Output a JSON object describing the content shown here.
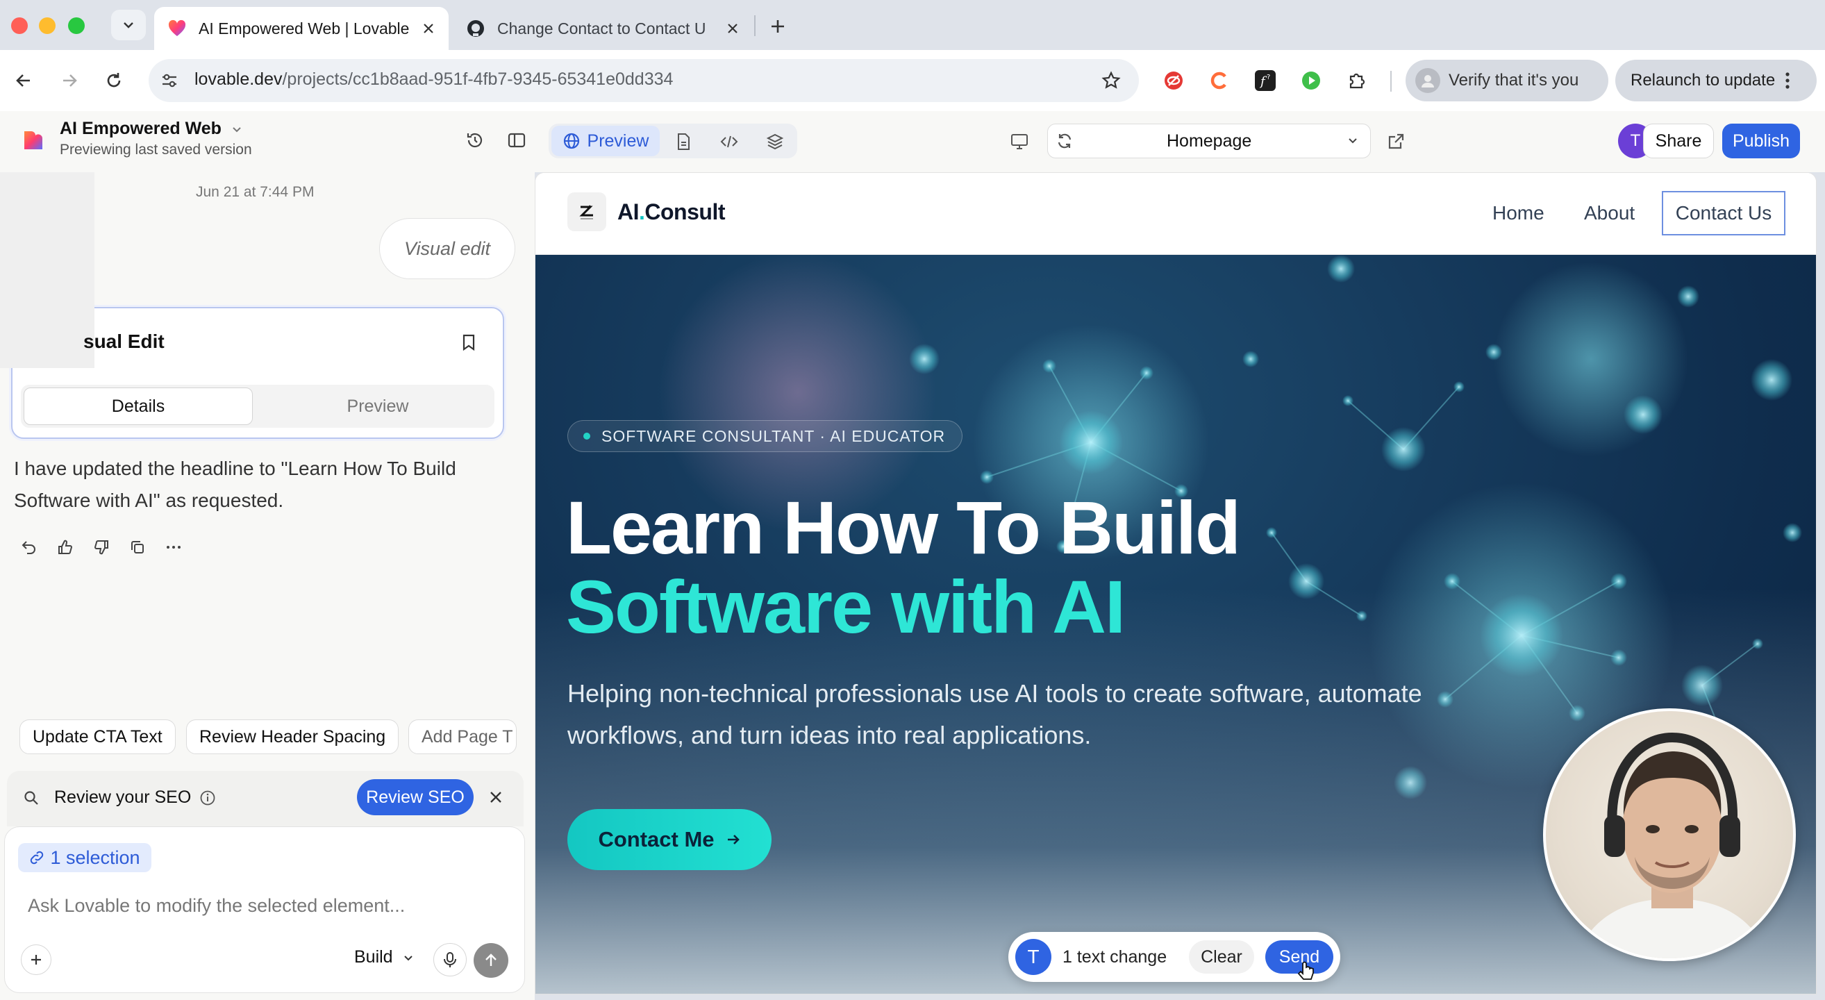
{
  "browser": {
    "tabs": [
      {
        "title": "AI Empowered Web | Lovable",
        "active": true
      },
      {
        "title": "Change Contact to Contact U",
        "active": false
      }
    ],
    "url_host": "lovable.dev",
    "url_path": "/projects/cc1b8aad-951f-4fb7-9345-65341e0dd334",
    "verify_label": "Verify that it's you",
    "relaunch_label": "Relaunch to update"
  },
  "header": {
    "project_name": "AI Empowered Web",
    "project_status": "Previewing last saved version",
    "preview_label": "Preview",
    "page_selected": "Homepage",
    "avatar_initial": "T",
    "share_label": "Share",
    "publish_label": "Publish"
  },
  "chat": {
    "date": "Jun 21 at 7:44 PM",
    "user_bubble": "Visual edit",
    "card_title": "sual Edit",
    "card_tabs": [
      "Details",
      "Preview"
    ],
    "assistant_message": "I have updated the headline to \"Learn How To Build Software with AI\" as requested.",
    "suggestions": [
      "Update CTA Text",
      "Review Header Spacing",
      "Add Page T"
    ],
    "seo_label": "Review your SEO",
    "seo_button": "Review SEO",
    "selection_chip": "1 selection",
    "input_placeholder": "Ask Lovable to modify the selected element...",
    "mode": "Build"
  },
  "site": {
    "brand_a": "AI",
    "brand_dot": ".",
    "brand_b": "Consult",
    "nav": [
      "Home",
      "About",
      "Contact Us"
    ],
    "badge": "SOFTWARE CONSULTANT · AI EDUCATOR",
    "headline_line1": "Learn How To Build",
    "headline_line2": "Software with AI",
    "subheadline": "Helping non-technical professionals use AI tools to create software, automate workflows, and turn ideas into real applications.",
    "cta": "Contact Me"
  },
  "change_bar": {
    "avatar": "T",
    "text": "1 text change",
    "clear": "Clear",
    "send": "Send"
  },
  "colors": {
    "accent_blue": "#2f64e2",
    "teal": "#2ee6d6",
    "hero_bg": "#0f2d4d"
  }
}
